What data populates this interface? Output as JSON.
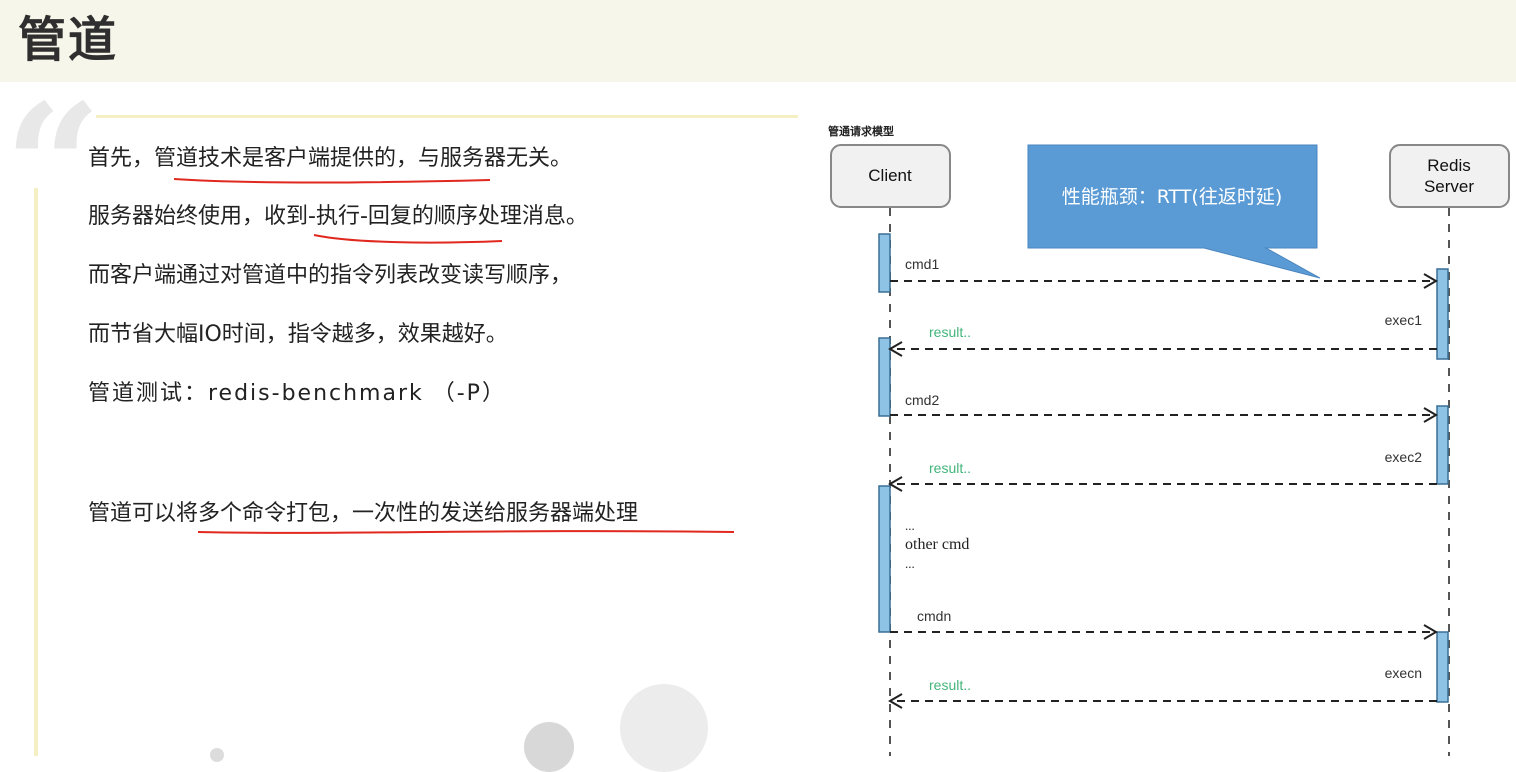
{
  "title": "管道",
  "lines": {
    "l1": {
      "a": "首先，",
      "u": "管道技术是客户端提供的，",
      "b": "与服务器无关。"
    },
    "l2": {
      "a": "服务器始终使用，",
      "u": "收到-执行-回复",
      "b": "的顺序处理消息。"
    },
    "l3": "而客户端通过对管道中的指令列表改变读写顺序，",
    "l4": "而节省大幅IO时间，指令越多，效果越好。",
    "l5": "管道测试：redis-benchmark （-P）",
    "l6": {
      "a": "管道可以",
      "u": "将多个命令打包，一次性的发送给服务器端",
      "b": "处理"
    }
  },
  "diagram": {
    "caption": "管通请求模型",
    "client_label": "Client",
    "server_label": [
      "Redis",
      "Server"
    ],
    "callout": "性能瓶颈：RTT(往返时延)",
    "messages": [
      "cmd1",
      "cmd2",
      "cmdn"
    ],
    "execs": [
      "exec1",
      "exec2",
      "execn"
    ],
    "result_label": "result..",
    "ellipsis": "...",
    "other_cmd": "other cmd",
    "colors": {
      "activation": "#8ec3e6",
      "callout": "#5b9bd5",
      "result_text": "#43b57a",
      "underline": "#e0281e"
    }
  }
}
